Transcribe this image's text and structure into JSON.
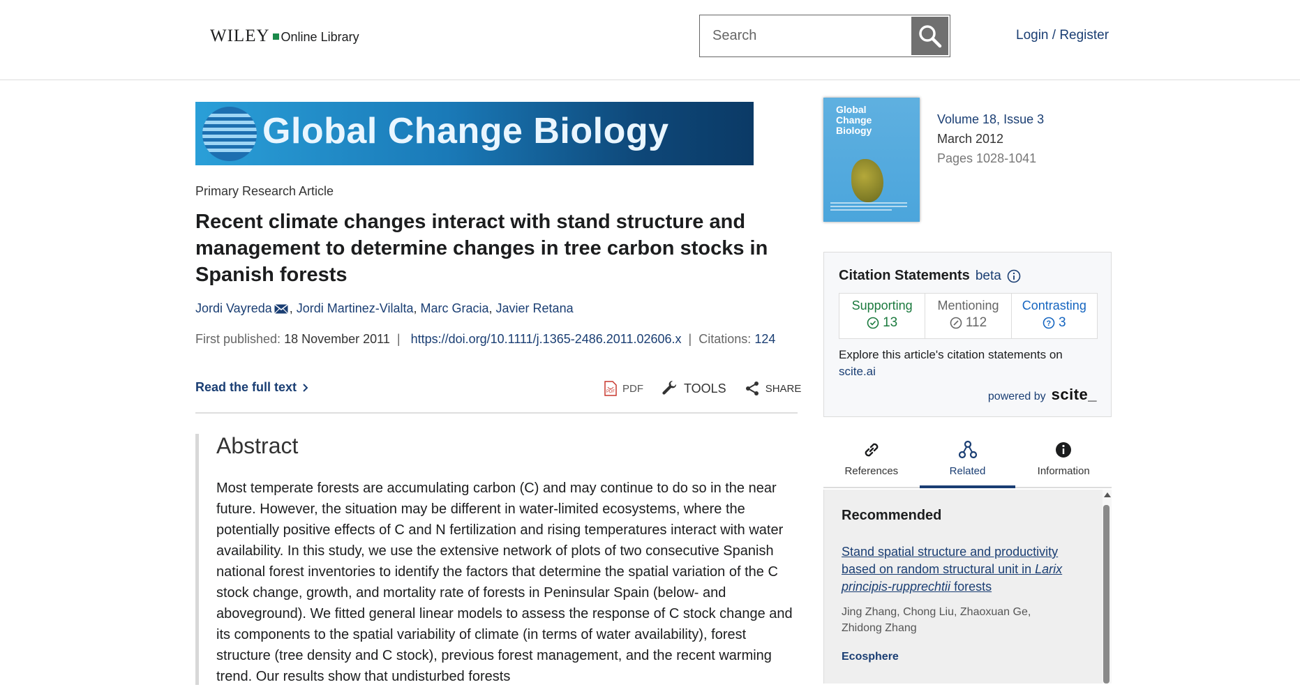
{
  "header": {
    "logo_wiley": "WILEY",
    "logo_online": "Online Library",
    "search_placeholder": "Search",
    "login": "Login / Register"
  },
  "journal": {
    "banner_title": "Global Change Biology",
    "cover_title_lines": [
      "Global",
      "Change",
      "Biology"
    ],
    "volume": "Volume 18, Issue 3",
    "date": "March 2012",
    "pages": "Pages 1028-1041"
  },
  "article": {
    "type": "Primary Research Article",
    "title": "Recent climate changes interact with stand structure and management to determine changes in tree carbon stocks in Spanish forests",
    "authors": [
      "Jordi Vayreda",
      "Jordi Martinez-Vilalta",
      "Marc Gracia",
      "Javier Retana"
    ],
    "first_published_label": "First published:",
    "first_published": "18 November 2011",
    "doi": "https://doi.org/10.1111/j.1365-2486.2011.02606.x",
    "citations_label": "Citations:",
    "citations": "124",
    "read_full": "Read the full text",
    "tools": {
      "pdf": "PDF",
      "tools": "TOOLS",
      "share": "SHARE"
    }
  },
  "abstract": {
    "heading": "Abstract",
    "text": "Most temperate forests are accumulating carbon (C) and may continue to do so in the near future. However, the situation may be different in water-limited ecosystems, where the potentially positive effects of C and N fertilization and rising temperatures interact with water availability. In this study, we use the extensive network of plots of two consecutive Spanish national forest inventories to identify the factors that determine the spatial variation of the C stock change, growth, and mortality rate of forests in Peninsular Spain (below- and aboveground). We fitted general linear models to assess the response of C stock change and its components to the spatial variability of climate (in terms of water availability), forest structure (tree density and C stock), previous forest management, and the recent warming trend. Our results show that undisturbed forests"
  },
  "citation_statements": {
    "title": "Citation Statements",
    "beta": "beta",
    "supporting_label": "Supporting",
    "supporting": "13",
    "mentioning_label": "Mentioning",
    "mentioning": "112",
    "contrasting_label": "Contrasting",
    "contrasting": "3",
    "explore": "Explore this article's citation statements on",
    "explore_link": "scite.ai",
    "powered_by": "powered by",
    "scite": "scite_",
    "colors": {
      "supporting": "#1b7a3e",
      "mentioning": "#666666",
      "contrasting": "#1565c0"
    }
  },
  "tabs": [
    {
      "label": "References",
      "icon": "link-icon"
    },
    {
      "label": "Related",
      "icon": "related-icon",
      "active": true
    },
    {
      "label": "Information",
      "icon": "info-icon"
    }
  ],
  "recommended": {
    "heading": "Recommended",
    "title_pre": "Stand spatial structure and productivity based on random structural unit in ",
    "title_italic": "Larix principis-rupprechtii",
    "title_post": " forests",
    "authors": [
      "Jing Zhang",
      "Chong Liu",
      "Zhaoxuan Ge",
      "Zhidong Zhang"
    ],
    "journal": "Ecosphere"
  }
}
